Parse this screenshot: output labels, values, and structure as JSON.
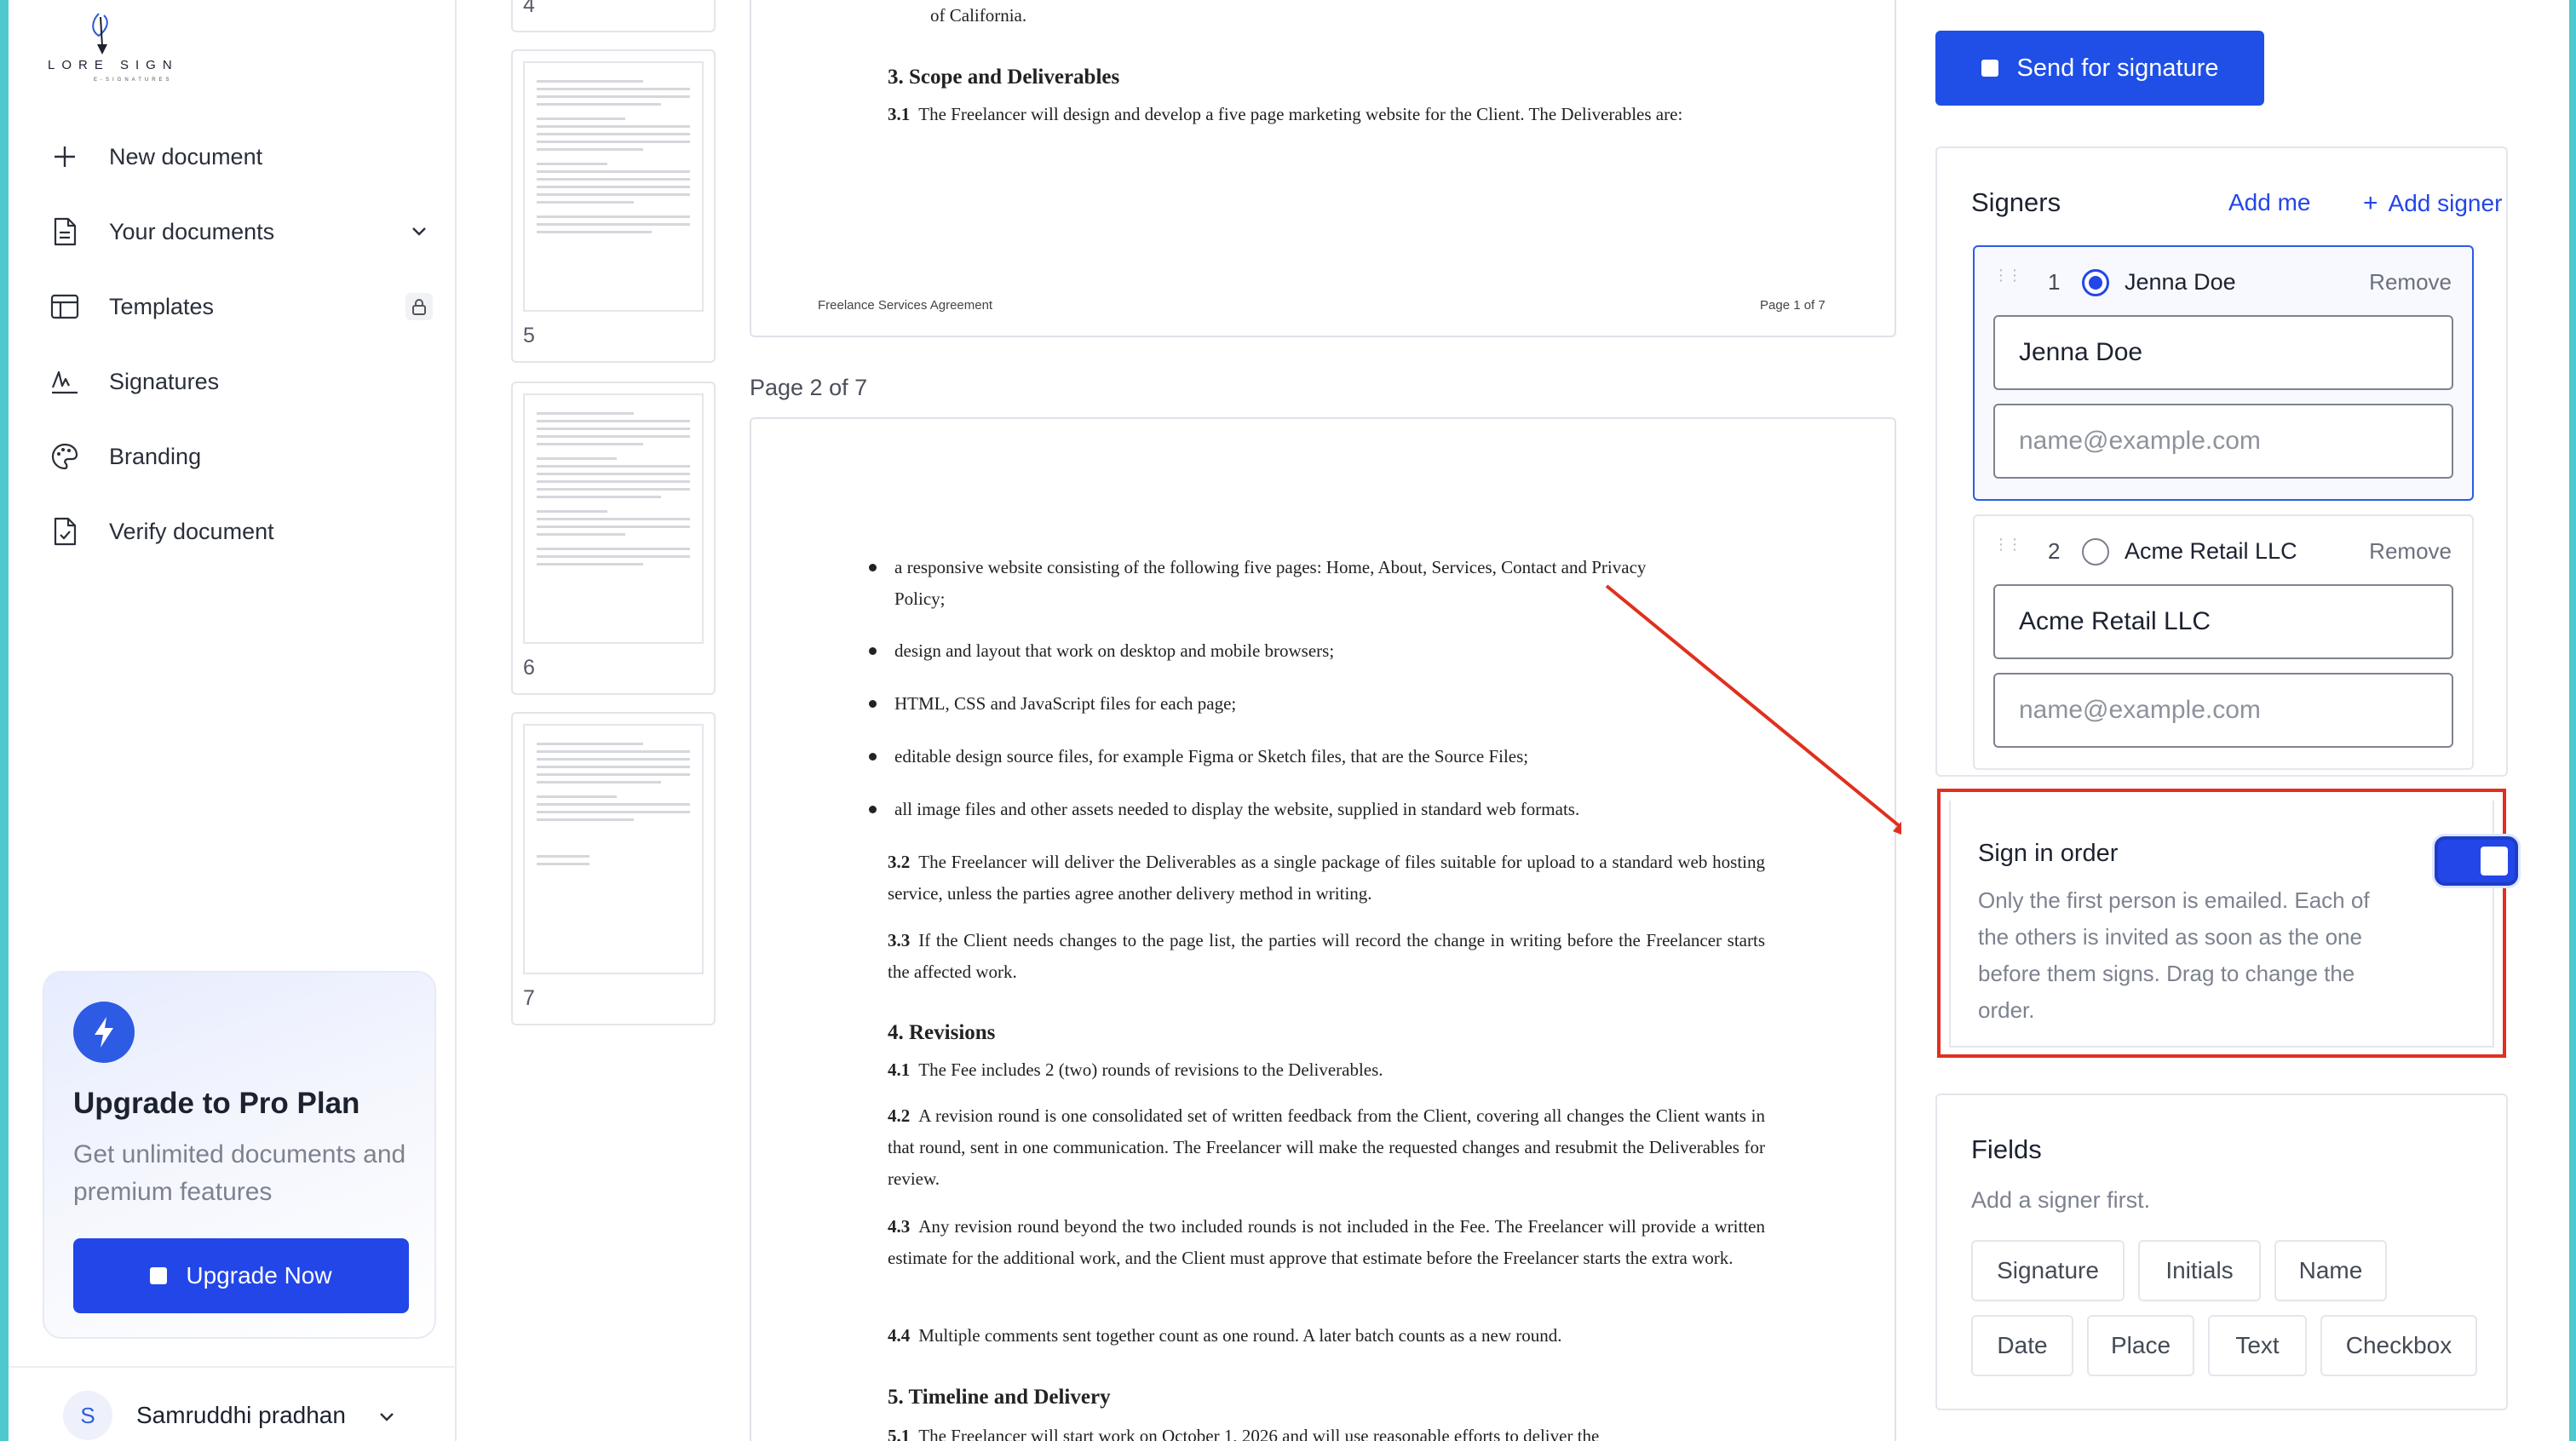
{
  "app": {
    "logo_text": "LORE  SIGN",
    "logo_sub": "E-SIGNATURES"
  },
  "sidebar": {
    "items": [
      {
        "label": "New document",
        "icon": "plus-icon"
      },
      {
        "label": "Your documents",
        "icon": "document-icon",
        "right": "chevron-down-icon"
      },
      {
        "label": "Templates",
        "icon": "template-icon",
        "right": "lock-icon"
      },
      {
        "label": "Signatures",
        "icon": "signature-icon"
      },
      {
        "label": "Branding",
        "icon": "palette-icon"
      },
      {
        "label": "Verify document",
        "icon": "verify-icon"
      }
    ],
    "upgrade": {
      "title": "Upgrade to Pro Plan",
      "description": "Get unlimited documents and premium features",
      "button": "Upgrade Now"
    },
    "user": {
      "initial": "S",
      "name": "Samruddhi pradhan"
    }
  },
  "thumbnails": {
    "pages": [
      "4",
      "5",
      "6",
      "7"
    ]
  },
  "document": {
    "page_label": "Page 2 of 7",
    "page1": {
      "top_line": "of California.",
      "section3_title": "3. Scope and Deliverables",
      "clause_3_1_num": "3.1",
      "clause_3_1": "The Freelancer will design and develop a five page marketing website for the Client. The Deliverables are:",
      "footer_left": "Freelance Services Agreement",
      "footer_right": "Page 1 of 7"
    },
    "page2": {
      "bullets": [
        "a responsive website consisting of the following five pages: Home, About, Services, Contact and Privacy Policy;",
        "design and layout that work on desktop and mobile browsers;",
        "HTML, CSS and JavaScript files for each page;",
        "editable design source files, for example Figma or Sketch files, that are the Source Files;",
        "all image files and other assets needed to display the website, supplied in standard web formats."
      ],
      "clause_3_2_num": "3.2",
      "clause_3_2": "The Freelancer will deliver the Deliverables as a single package of files suitable for upload to a standard web hosting service, unless the parties agree another delivery method in writing.",
      "clause_3_3_num": "3.3",
      "clause_3_3": "If the Client needs changes to the page list, the parties will record the change in writing before the Freelancer starts the affected work.",
      "section4_title": "4. Revisions",
      "clause_4_1_num": "4.1",
      "clause_4_1": "The Fee includes 2 (two) rounds of revisions to the Deliverables.",
      "clause_4_2_num": "4.2",
      "clause_4_2": "A revision round is one consolidated set of written feedback from the Client, covering all changes the Client wants in that round, sent in one communication. The Freelancer will make the requested changes and resubmit the Deliverables for review.",
      "clause_4_3_num": "4.3",
      "clause_4_3": "Any revision round beyond the two included rounds is not included in the Fee. The Freelancer will provide a written estimate for the additional work, and the Client must approve that estimate before the Freelancer starts the extra work.",
      "clause_4_4_num": "4.4",
      "clause_4_4": "Multiple comments sent together count as one round. A later batch counts as a new round.",
      "section5_title": "5. Timeline and Delivery",
      "clause_5_1_num": "5.1",
      "clause_5_1": "The Freelancer will start work on October 1, 2026 and will use reasonable efforts to deliver the"
    }
  },
  "panel": {
    "send_button": "Send for signature",
    "signers": {
      "title": "Signers",
      "add_me": "Add me",
      "add_signer": "Add signer",
      "list": [
        {
          "order": "1",
          "name": "Jenna Doe",
          "name_value": "Jenna Doe",
          "email_placeholder": "name@example.com",
          "remove": "Remove",
          "selected": true
        },
        {
          "order": "2",
          "name": "Acme Retail LLC",
          "name_value": "Acme Retail LLC",
          "email_placeholder": "name@example.com",
          "remove": "Remove",
          "selected": false
        }
      ]
    },
    "sign_in_order": {
      "title": "Sign in order",
      "description": "Only the first person is emailed. Each of the others is invited as soon as the one before them signs. Drag to change the order.",
      "enabled": true
    },
    "fields": {
      "title": "Fields",
      "hint": "Add a signer first.",
      "chips": [
        "Signature",
        "Initials",
        "Name",
        "Date",
        "Place",
        "Text",
        "Checkbox"
      ]
    }
  },
  "colors": {
    "accent": "#2346e8",
    "frame": "#4dc9cf",
    "annotation": "#e0301e"
  }
}
